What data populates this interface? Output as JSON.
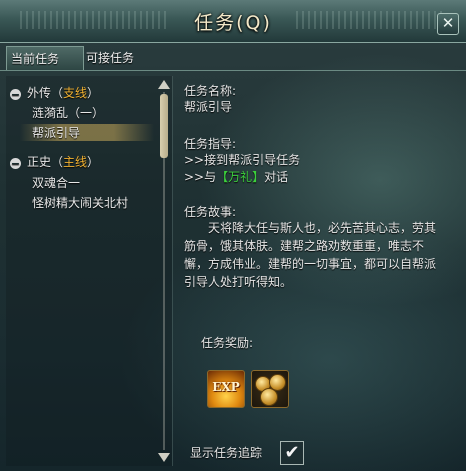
{
  "window": {
    "title": "任务(Q)",
    "close_icon": "✕"
  },
  "tabs": [
    {
      "label": "当前任务",
      "active": true
    },
    {
      "label": "可接任务",
      "active": false
    }
  ],
  "quest_list": {
    "categories": [
      {
        "name_prefix": "外传（",
        "name_type": "支线",
        "name_suffix": "）",
        "expanded_symbol": "−",
        "items": [
          "涟漪乱（一）",
          "帮派引导"
        ]
      },
      {
        "name_prefix": "正史（",
        "name_type": "主线",
        "name_suffix": "）",
        "expanded_symbol": "−",
        "items": [
          "双魂合一",
          "怪树精大闹关北村"
        ]
      }
    ],
    "selected_item": "帮派引导"
  },
  "detail": {
    "name_label": "任务名称:",
    "name_value": "帮派引导",
    "guide_label": "任务指导:",
    "guide_line1": ">>接到帮派引导任务",
    "guide_line2_prefix": ">>与",
    "guide_line2_link": "【万礼】",
    "guide_line2_suffix": "对话",
    "story_label": "任务故事:",
    "story_text": "天将降大任与斯人也，必先苦其心志，劳其筋骨，饿其体肤。建帮之路劝数重重，唯志不懈，方成伟业。建帮的一切事宜，都可以自帮派引导人处打听得知。",
    "reward_label": "任务奖励:",
    "rewards": [
      {
        "icon": "exp-icon",
        "text": "EXP"
      },
      {
        "icon": "coin-icon",
        "text": ""
      }
    ]
  },
  "track": {
    "label": "显示任务追踪",
    "checked": true,
    "check_glyph": "✔"
  },
  "colors": {
    "link_green": "#3cd03c",
    "category_orange": "#f0b030"
  }
}
